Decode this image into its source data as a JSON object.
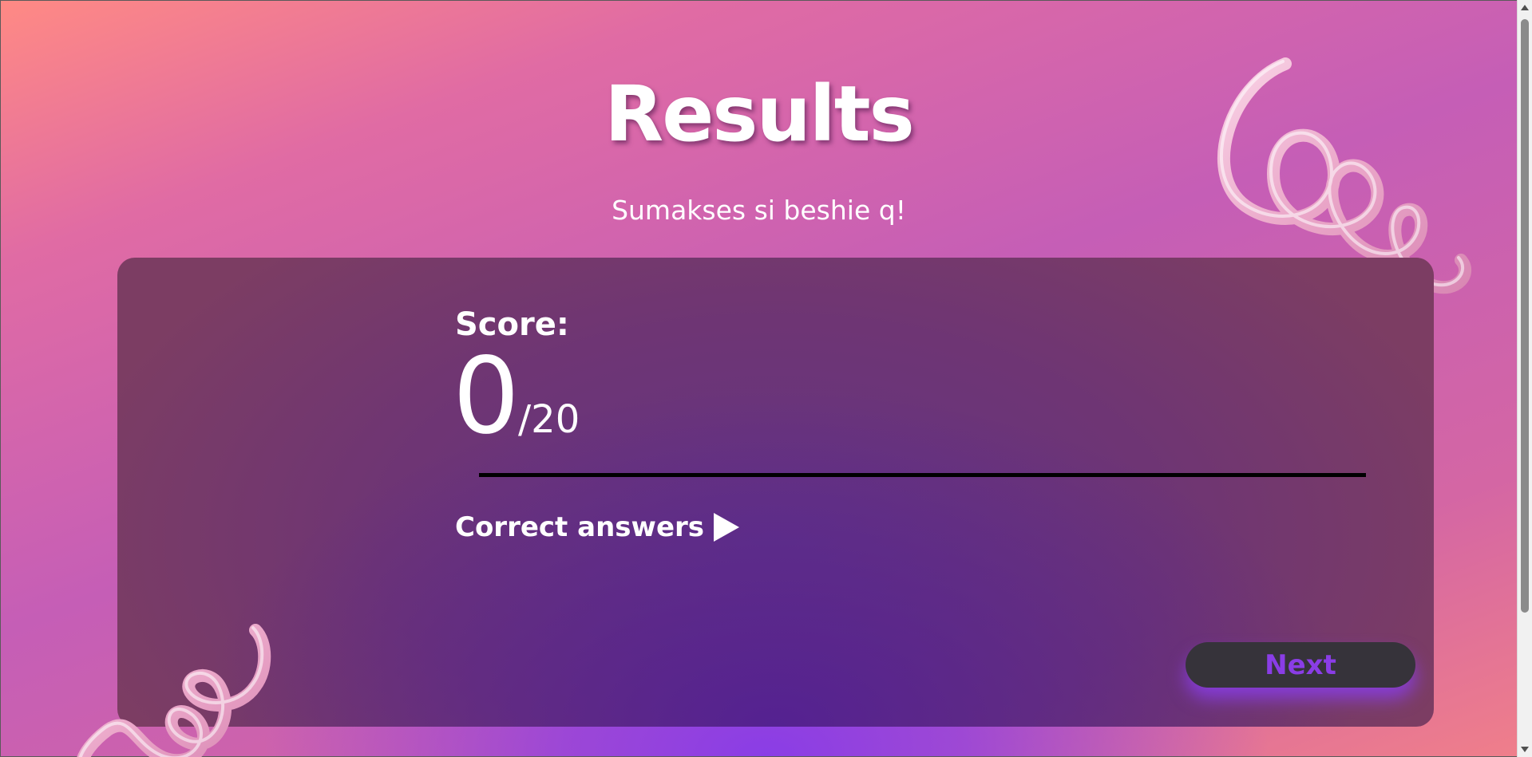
{
  "page": {
    "title": "Results",
    "subtitle": "Sumakses si beshie q!"
  },
  "score": {
    "label": "Score:",
    "value": "0",
    "total": "/20"
  },
  "correct_answers": {
    "label": "Correct answers"
  },
  "actions": {
    "next_label": "Next"
  },
  "colors": {
    "accent": "#8a3de6",
    "button_bg": "#36333a",
    "text": "#ffffff"
  },
  "decorations": [
    "spiral-top-right",
    "spiral-bottom-left"
  ]
}
